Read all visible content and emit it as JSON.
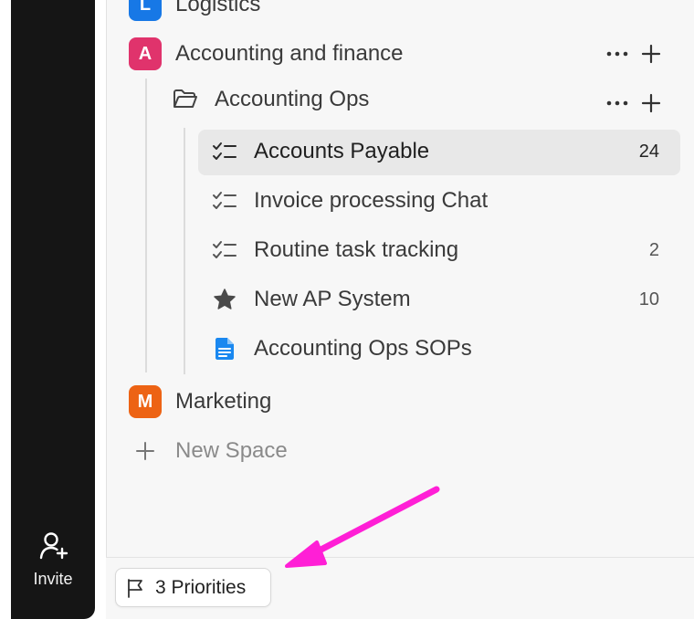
{
  "left_rail": {
    "invite_label": "Invite"
  },
  "spaces": [
    {
      "badge": "L",
      "name": "Logistics",
      "badge_color": "#1778e6"
    },
    {
      "badge": "A",
      "name": "Accounting and finance",
      "badge_color": "#e0336c"
    },
    {
      "badge": "M",
      "name": "Marketing",
      "badge_color": "#ed6314"
    }
  ],
  "folder": {
    "name": "Accounting Ops"
  },
  "lists": [
    {
      "icon": "checklist-icon",
      "name": "Accounts Payable",
      "count": "24",
      "selected": true
    },
    {
      "icon": "checklist-icon",
      "name": "Invoice processing Chat",
      "count": ""
    },
    {
      "icon": "checklist-icon",
      "name": "Routine task tracking",
      "count": "2"
    },
    {
      "icon": "star-icon",
      "name": "New AP System",
      "count": "10"
    },
    {
      "icon": "document-icon",
      "name": "Accounting Ops SOPs",
      "count": ""
    }
  ],
  "new_space_label": "New Space",
  "priorities_label": "3 Priorities",
  "colors": {
    "annotation_arrow": "#ff1fd6",
    "doc_icon": "#1a88f0"
  }
}
